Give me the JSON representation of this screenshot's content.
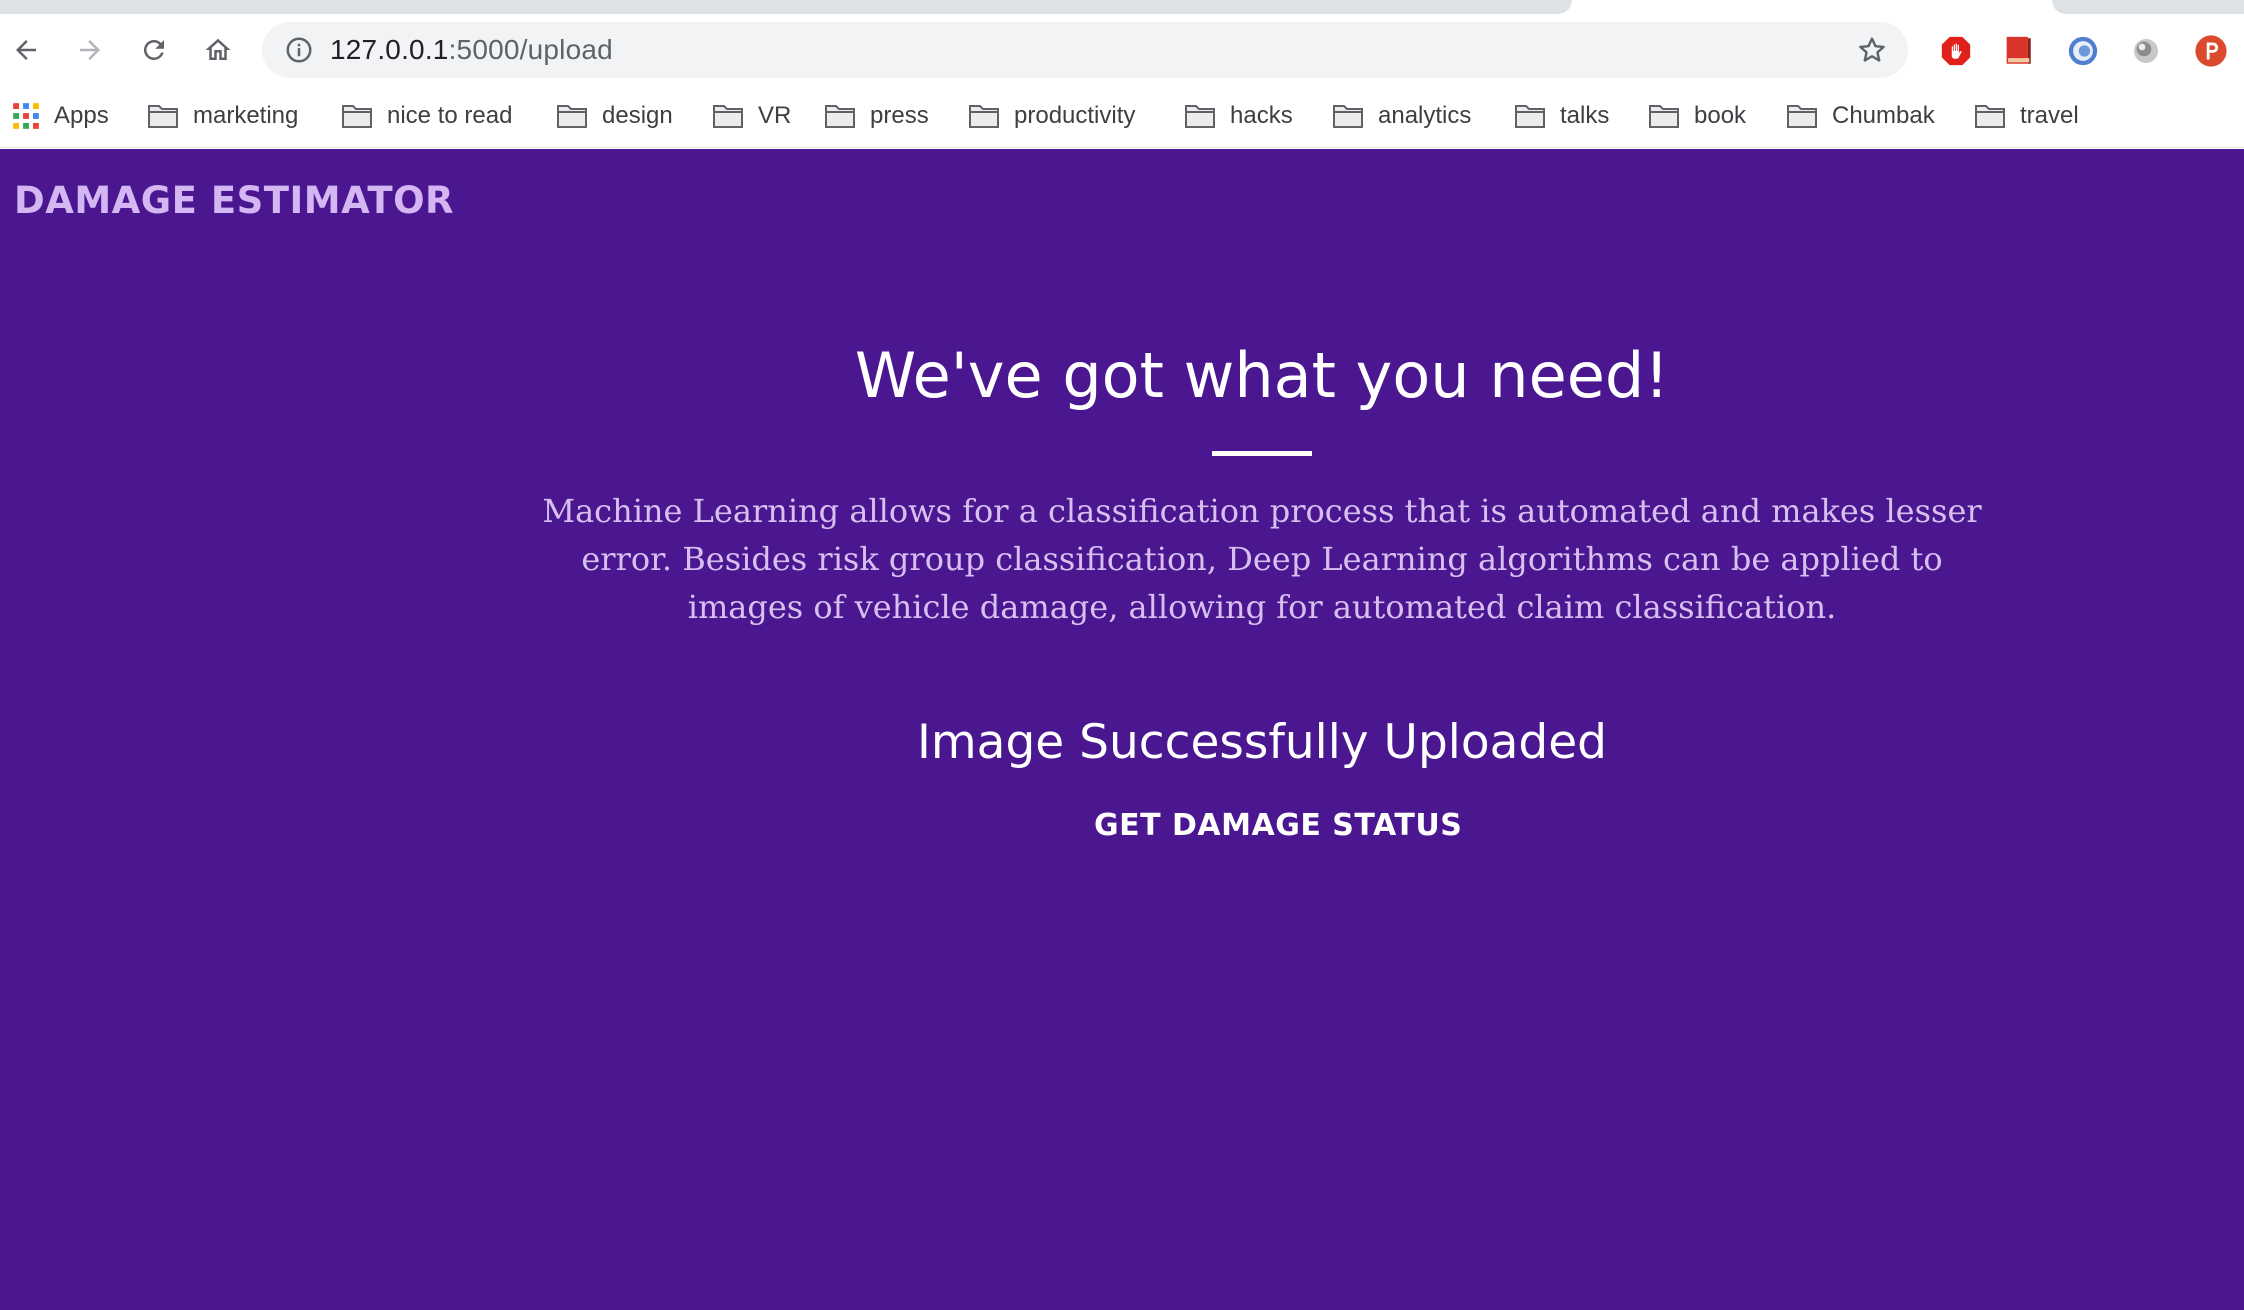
{
  "browser": {
    "url_host": "127.0.0.1",
    "url_path": ":5000/upload",
    "bookmarks": [
      {
        "label": "Apps",
        "icon": "apps-grid-icon"
      },
      {
        "label": "marketing",
        "icon": "folder-icon"
      },
      {
        "label": "nice to read",
        "icon": "folder-icon"
      },
      {
        "label": "design",
        "icon": "folder-icon"
      },
      {
        "label": "VR",
        "icon": "folder-icon"
      },
      {
        "label": "press",
        "icon": "folder-icon"
      },
      {
        "label": "productivity",
        "icon": "folder-icon"
      },
      {
        "label": "hacks",
        "icon": "folder-icon"
      },
      {
        "label": "analytics",
        "icon": "folder-icon"
      },
      {
        "label": "talks",
        "icon": "folder-icon"
      },
      {
        "label": "book",
        "icon": "folder-icon"
      },
      {
        "label": "Chumbak",
        "icon": "folder-icon"
      },
      {
        "label": "travel",
        "icon": "folder-icon"
      }
    ],
    "extensions": [
      "adblock-icon",
      "bookmark-extension-icon",
      "spiral-extension-icon",
      "grey-circle-extension-icon",
      "p-extension-icon"
    ]
  },
  "page": {
    "brand": "DAMAGE ESTIMATOR",
    "hero_title": "We've got what you need!",
    "hero_text": "Machine Learning allows for a classification process that is automated and makes lesser error. Besides risk group classification, Deep Learning algorithms can be applied to images of vehicle damage, allowing for automated claim classification.",
    "status": "Image Successfully Uploaded",
    "action_label": "GET DAMAGE STATUS"
  },
  "colors": {
    "page_background": "#4a1790",
    "brand": "#d3b6f2",
    "hero_text": "#d7c0f0",
    "heading": "#ffffff"
  }
}
